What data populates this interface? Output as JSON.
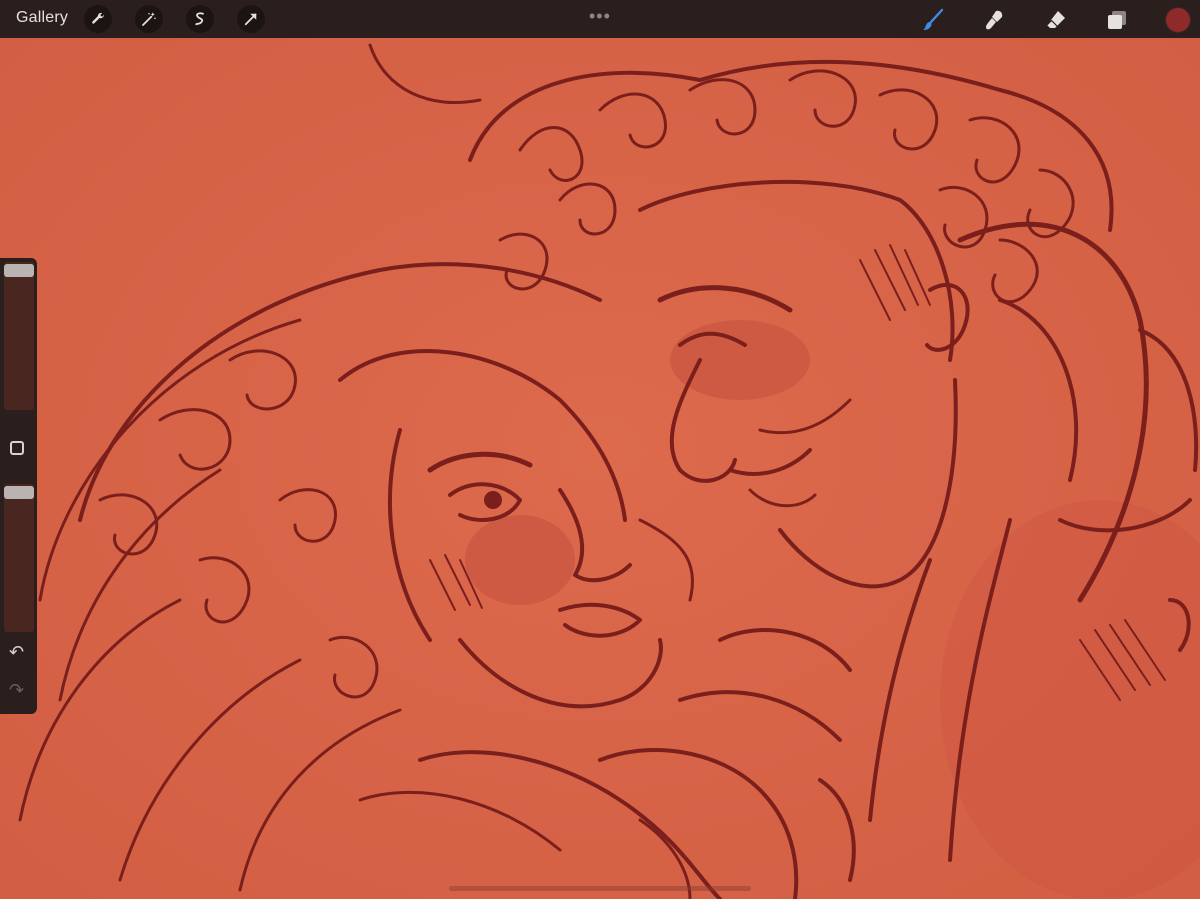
{
  "app": {
    "gallery_label": "Gallery",
    "accent_color": "#d9664a",
    "ink_color": "#7a1f1c",
    "toolbar_bg": "#2b1f1d",
    "current_color": "#8f2a2a"
  },
  "toolbar_left": [
    {
      "icon": "wrench-icon"
    },
    {
      "icon": "magic-wand-icon"
    },
    {
      "icon": "selection-icon"
    },
    {
      "icon": "transform-arrow-icon"
    }
  ],
  "toolbar_right": [
    {
      "icon": "brush-icon",
      "active": true
    },
    {
      "icon": "smudge-icon"
    },
    {
      "icon": "eraser-icon"
    },
    {
      "icon": "layers-icon"
    }
  ],
  "sidebar": {
    "brush_size_level": 1.0,
    "opacity_level": 1.0,
    "undo_icon": "undo-icon",
    "redo_icon": "redo-icon"
  },
  "more_label": "•••"
}
